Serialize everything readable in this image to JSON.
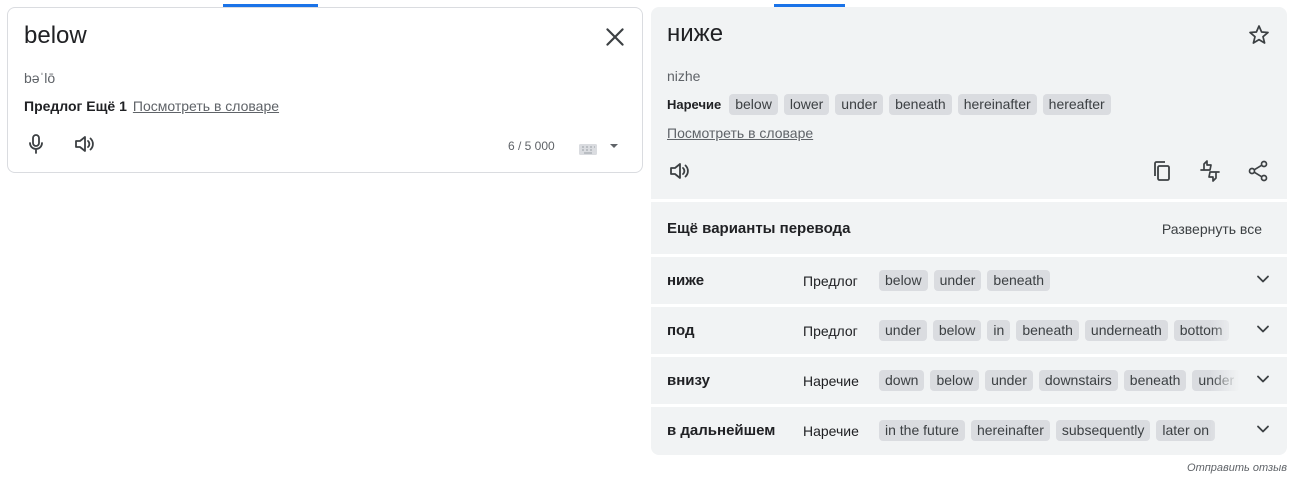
{
  "source": {
    "text": "below",
    "transliteration": "bəˈlō",
    "pos_label": "Предлог Ещё 1",
    "dictionary_link": "Посмотреть в словаре",
    "char_count": "6 / 5 000"
  },
  "target": {
    "text": "ниже",
    "transliteration": "nizhe",
    "pos_label": "Наречие",
    "synonyms": [
      "below",
      "lower",
      "under",
      "beneath",
      "hereinafter",
      "hereafter"
    ],
    "dictionary_link": "Посмотреть в словаре"
  },
  "alternatives": {
    "title": "Ещё варианты перевода",
    "expand_all": "Развернуть все",
    "rows": [
      {
        "word": "ниже",
        "pos": "Предлог",
        "chips": [
          "below",
          "under",
          "beneath"
        ]
      },
      {
        "word": "под",
        "pos": "Предлог",
        "chips": [
          "under",
          "below",
          "in",
          "beneath",
          "underneath",
          "bottom"
        ]
      },
      {
        "word": "внизу",
        "pos": "Наречие",
        "chips": [
          "down",
          "below",
          "under",
          "downstairs",
          "beneath",
          "under"
        ]
      },
      {
        "word": "в дальнейшем",
        "pos": "Наречие",
        "chips": [
          "in the future",
          "hereinafter",
          "subsequently",
          "later on"
        ]
      }
    ]
  },
  "footer": {
    "send_feedback": "Отправить отзыв"
  },
  "icons": {
    "close": "close-icon",
    "mic": "mic-icon",
    "speaker": "speaker-icon",
    "keyboard": "keyboard-icon",
    "dropdown": "arrow-drop-down-icon",
    "star": "star-icon",
    "copy": "copy-icon",
    "feedback": "thumbs-feedback-icon",
    "share": "share-icon",
    "chevron": "chevron-down-icon"
  },
  "colors": {
    "accent": "#1a73e8",
    "panel_bg": "#f1f3f4",
    "chip_bg": "#dadce0",
    "text": "#202124",
    "muted": "#5f6368"
  }
}
